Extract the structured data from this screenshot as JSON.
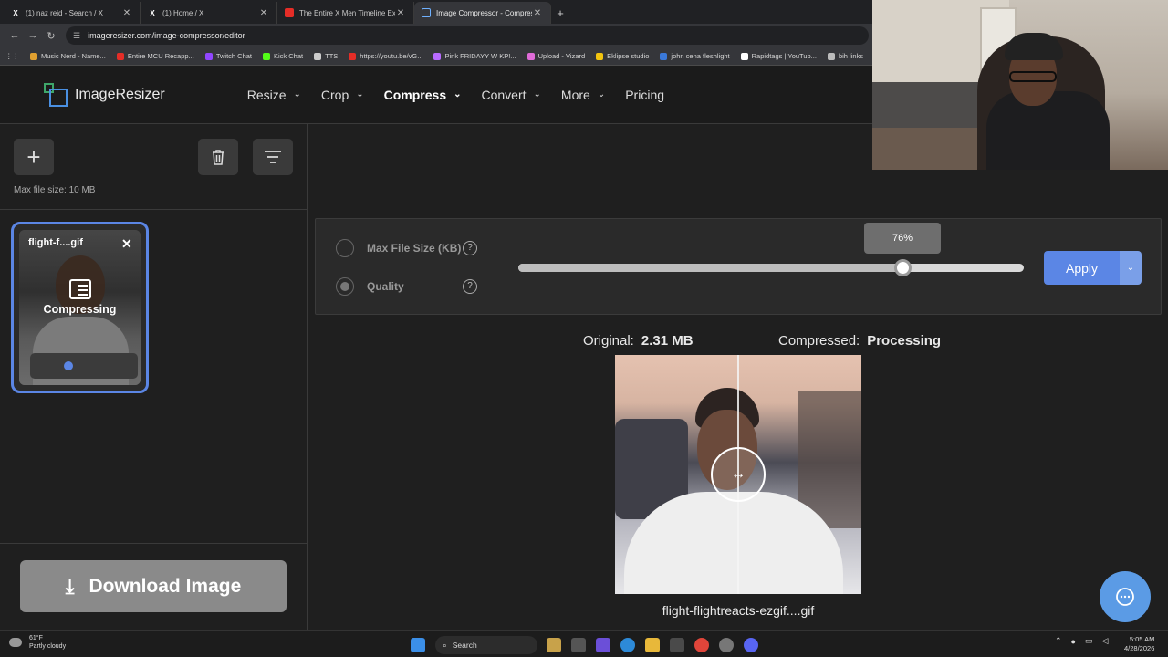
{
  "browser": {
    "tabs": [
      {
        "title": "(1) naz reid - Search / X",
        "icon": "x-icon"
      },
      {
        "title": "(1) Home / X",
        "icon": "x-icon"
      },
      {
        "title": "The Entire X Men Timeline Expl",
        "icon": "youtube-icon"
      },
      {
        "title": "Image Compressor - Compress",
        "icon": "imageresizer-icon"
      }
    ],
    "url": "imageresizer.com/image-compressor/editor",
    "bookmarks": [
      "Music Nerd - Name...",
      "Entire MCU Recapp...",
      "Twitch Chat",
      "Kick Chat",
      "TTS",
      "https://youtu.be/vG...",
      "Pink FRIDAYY W KP!...",
      "Upload - Vizard",
      "Eklipse studio",
      "john cena fleshlight",
      "Rapidtags | YouTub...",
      "bih links"
    ]
  },
  "site": {
    "logo": "ImageResizer",
    "nav": [
      "Resize",
      "Crop",
      "Compress",
      "Convert",
      "More",
      "Pricing"
    ]
  },
  "left": {
    "max_file_size": "Max file size: 10 MB",
    "thumb_name": "flight-f....gif",
    "thumb_status": "Compressing",
    "download_label": "Download Image"
  },
  "settings": {
    "option_max": "Max File Size (KB)",
    "option_quality": "Quality",
    "quality_percent": 76,
    "quality_label": "76%",
    "apply_label": "Apply"
  },
  "result": {
    "original_label": "Original:",
    "original_value": "2.31 MB",
    "compressed_label": "Compressed:",
    "compressed_value": "Processing",
    "filename": "flight-flightreacts-ezgif....gif"
  },
  "taskbar": {
    "temp": "61°F",
    "weather": "Partly cloudy",
    "search": "Search",
    "time": "5:05 AM",
    "date": "4/28/2026"
  }
}
